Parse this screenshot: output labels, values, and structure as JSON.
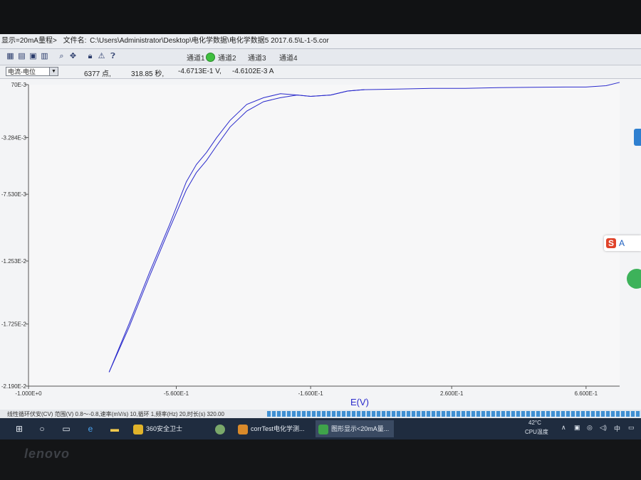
{
  "window": {
    "title_prefix": "显示=20mA量程>",
    "file_label": "文件名: ",
    "file_path": "C:\\Users\\Administrator\\Desktop\\电化学数据\\电化学数据5 2017.6.5\\L-1-5.cor"
  },
  "toolbar": {
    "icons": [
      "save-icon",
      "print-icon",
      "open-icon",
      "copy-icon",
      "zoom-icon",
      "tools-icon",
      "lock-icon",
      "warning-icon",
      "help-icon"
    ],
    "channels": [
      {
        "label": "通道1",
        "active": false
      },
      {
        "label": "通道2",
        "active": true
      },
      {
        "label": "通道3",
        "active": false
      },
      {
        "label": "通道4",
        "active": false
      }
    ],
    "channel_active_color": "#3fbf3f"
  },
  "status": {
    "mode_select": "电流-电位",
    "points": "6377 点,",
    "time": "318.85 秒,",
    "voltage": "-4.6713E-1 V,",
    "current": "-4.6102E-3 A"
  },
  "chart_data": {
    "type": "line",
    "xlabel": "E(V)",
    "ylabel": "",
    "xlim": [
      -1.0,
      0.76
    ],
    "ylim": [
      -0.0219,
      0.00068
    ],
    "x_ticks": [
      "-1.000E+0",
      "-5.600E-1",
      "-1.600E-1",
      "2.600E-1",
      "6.600E-1"
    ],
    "y_ticks": [
      "70E-3",
      "-3.284E-3",
      "-7.530E-3",
      "-1.253E-2",
      "-1.725E-2",
      "-2.190E-2"
    ],
    "series": [
      {
        "values_xy": [
          [
            -0.76,
            -0.02085
          ],
          [
            -0.7,
            -0.01745
          ],
          [
            -0.64,
            -0.0137
          ],
          [
            -0.58,
            -0.0101
          ],
          [
            -0.53,
            -0.0072
          ],
          [
            -0.5,
            -0.0059
          ],
          [
            -0.47,
            -0.005
          ],
          [
            -0.44,
            -0.0039
          ],
          [
            -0.4,
            -0.0025
          ],
          [
            -0.35,
            -0.0013
          ],
          [
            -0.3,
            -0.0006
          ],
          [
            -0.25,
            -0.0003
          ],
          [
            -0.2,
            -0.0001
          ],
          [
            -0.16,
            -0.0002
          ],
          [
            -0.1,
            -0.0001
          ],
          [
            -0.05,
            0.0002
          ],
          [
            0.0,
            0.0003
          ],
          [
            0.1,
            0.00035
          ],
          [
            0.2,
            0.0004
          ],
          [
            0.3,
            0.0004
          ],
          [
            0.4,
            0.00045
          ],
          [
            0.5,
            0.00048
          ],
          [
            0.6,
            0.0005
          ],
          [
            0.66,
            0.0005
          ],
          [
            0.72,
            0.0006
          ],
          [
            0.76,
            0.00085
          ]
        ],
        "color": "#2a2acc"
      },
      {
        "values_xy": [
          [
            -0.76,
            -0.02085
          ],
          [
            -0.7,
            -0.0172
          ],
          [
            -0.64,
            -0.0134
          ],
          [
            -0.58,
            -0.0098
          ],
          [
            -0.53,
            -0.0066
          ],
          [
            -0.5,
            -0.0053
          ],
          [
            -0.47,
            -0.0044
          ],
          [
            -0.44,
            -0.0033
          ],
          [
            -0.4,
            -0.002
          ],
          [
            -0.35,
            -0.0008
          ],
          [
            -0.3,
            -0.0003
          ],
          [
            -0.25,
            0.0
          ],
          [
            -0.2,
            -0.0001
          ],
          [
            -0.16,
            -0.0002
          ],
          [
            -0.1,
            -0.0001
          ],
          [
            -0.05,
            0.0002
          ],
          [
            0.0,
            0.0003
          ]
        ],
        "color": "#2a2acc"
      }
    ],
    "grid": false,
    "background": "#f7f7f8"
  },
  "progress": {
    "text": "线性循环伏安(CV) 范围(V) 0.8～-0.8,速率(mV/s) 10,循环 1,频率(Hz) 20,时长(s) 320.00",
    "fill_fraction": 1.0
  },
  "taskbar": {
    "icons": [
      "start-icon",
      "search-icon",
      "taskview-icon",
      "edge-icon",
      "explorer-icon"
    ],
    "apps": [
      {
        "label": "360安全卫士",
        "active": false,
        "color": "#e0b32a"
      },
      {
        "label": "",
        "active": false,
        "color": "#7aa86a"
      },
      {
        "label": "corrTest电化学测...",
        "active": false,
        "color": "#d98a2a"
      },
      {
        "label": "图形显示<20mA量...",
        "active": true,
        "color": "#3fa34a"
      }
    ],
    "temp": "42°C",
    "temp_label": "CPU温度",
    "tray_icons": [
      "chevron-up-icon",
      "network-icon",
      "speaker-icon",
      "ime-icon",
      "keyboard-icon",
      "notification-icon"
    ]
  },
  "float_widget": {
    "s": "S",
    "a": "A"
  },
  "brand": "lenovo"
}
